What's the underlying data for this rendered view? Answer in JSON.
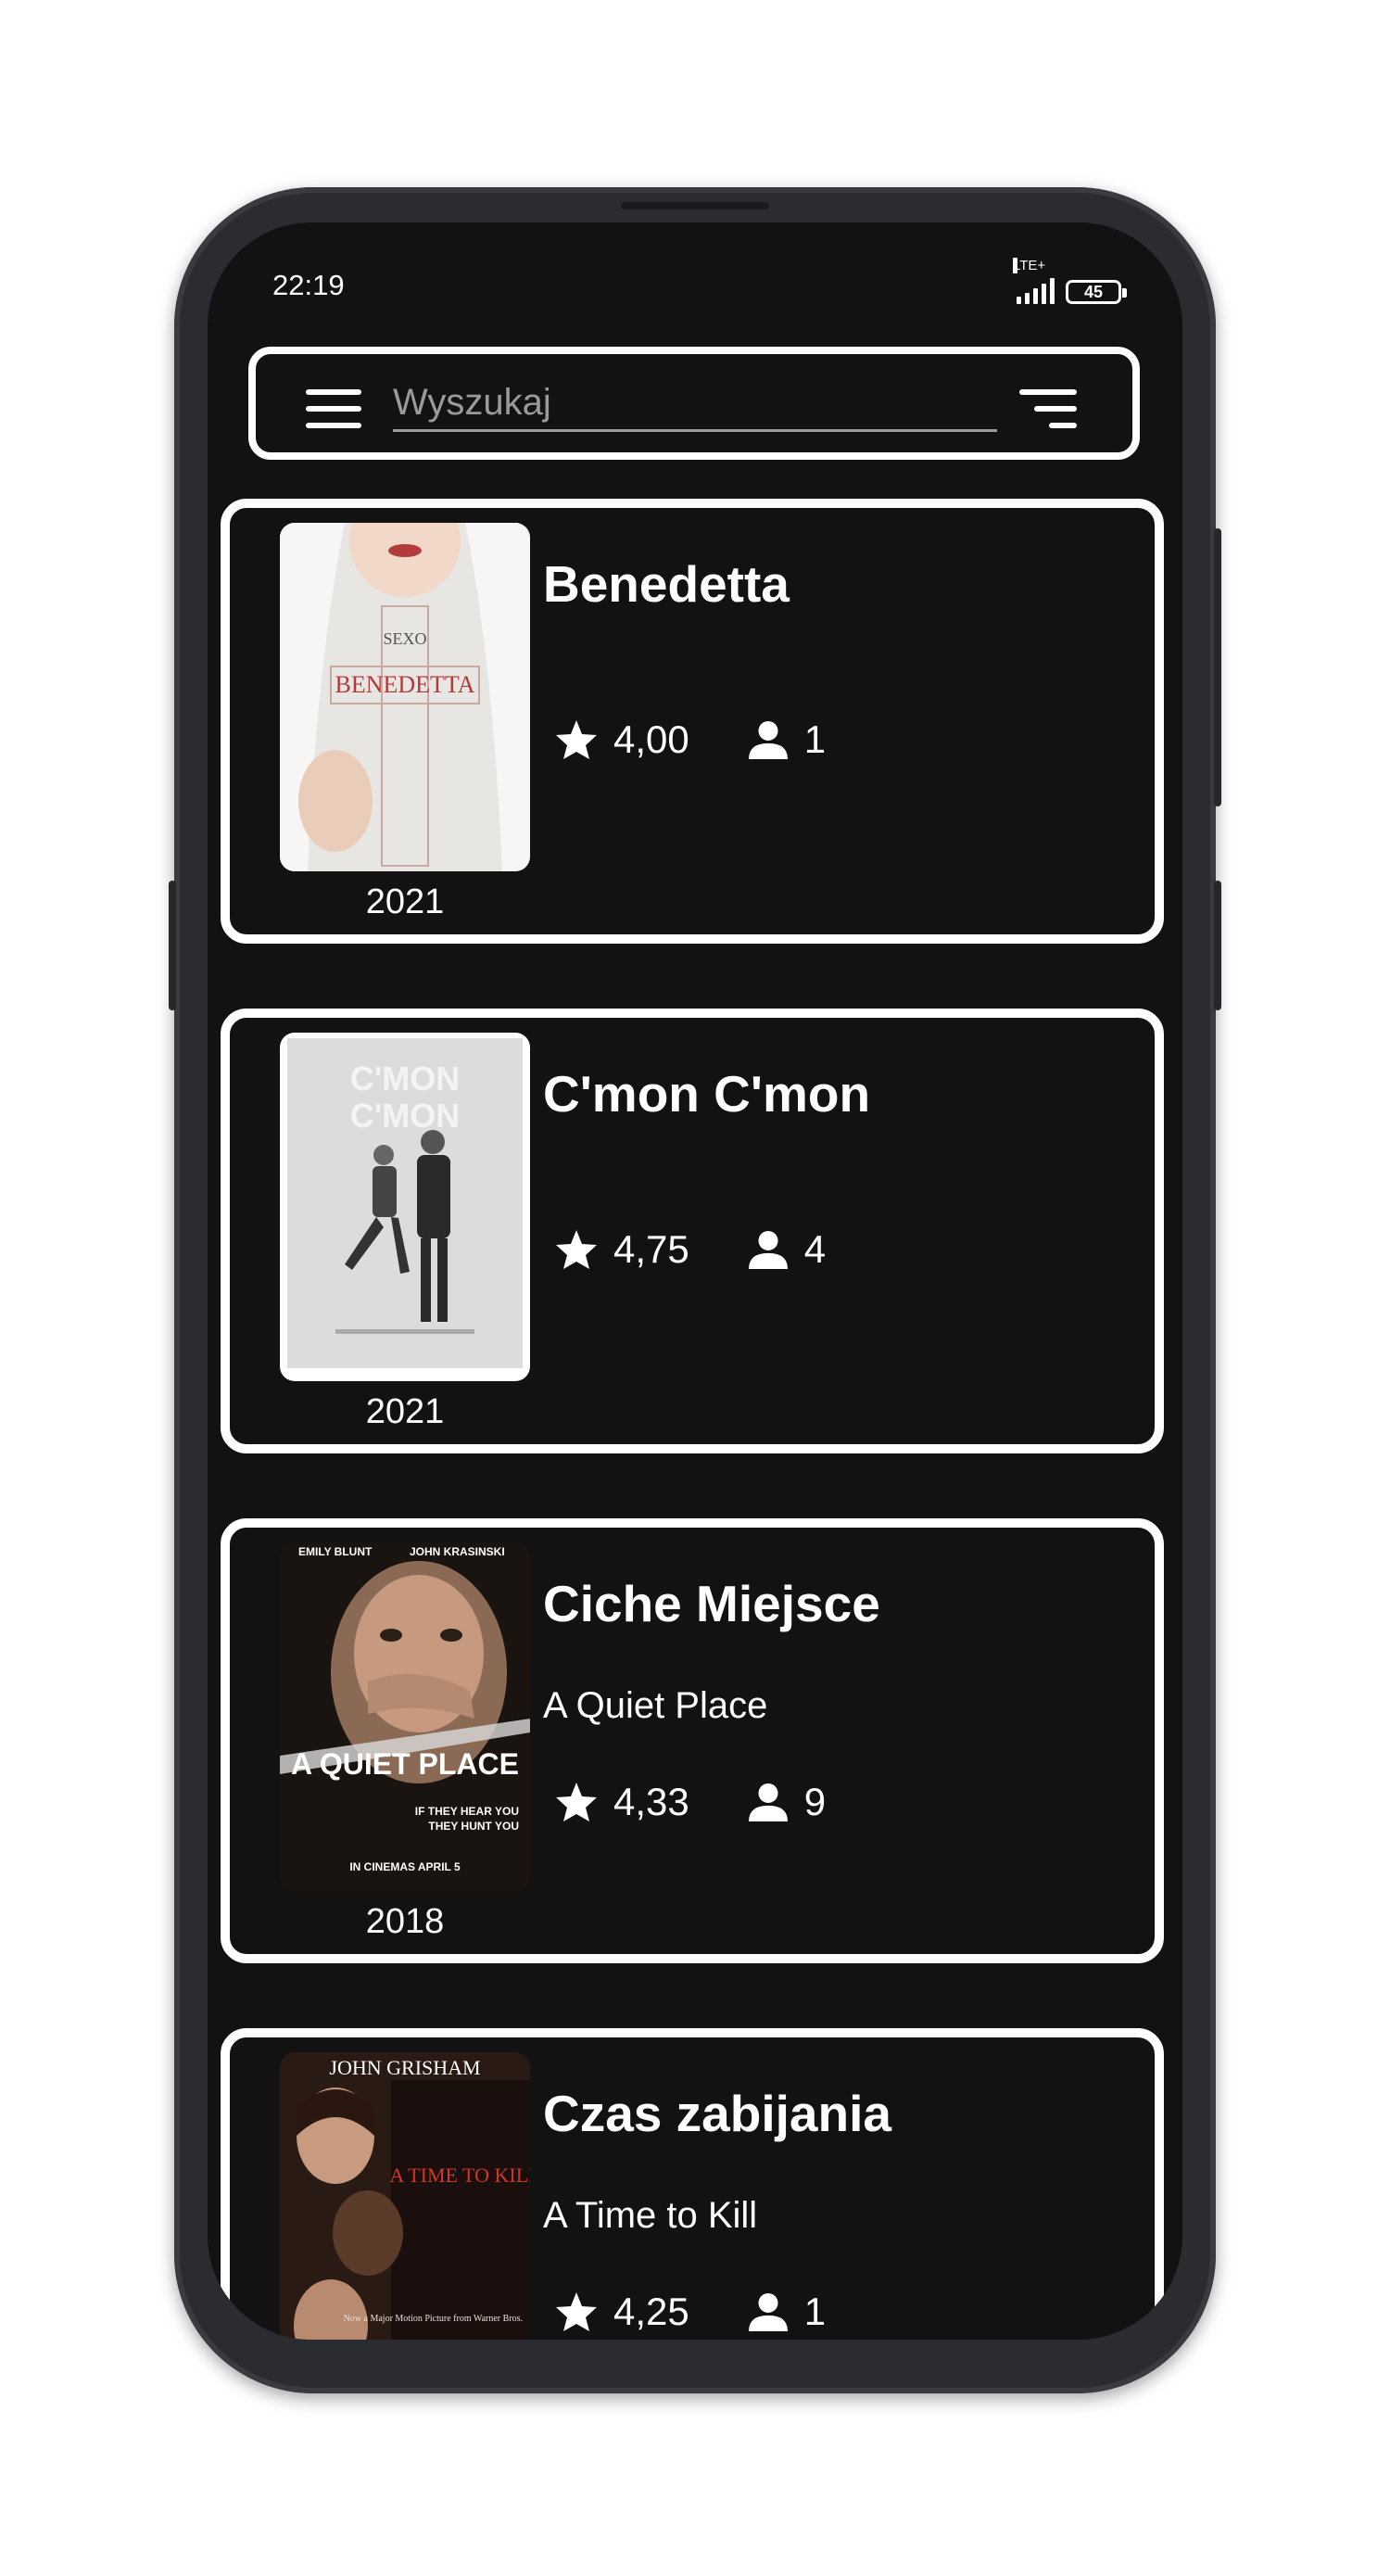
{
  "status_bar": {
    "time": "22:19",
    "network": "LTE+",
    "battery": "45"
  },
  "search": {
    "placeholder": "Wyszukaj",
    "value": ""
  },
  "icons": {
    "menu": "menu-icon",
    "sort": "sort-icon",
    "rating": "star-icon",
    "votes": "person-icon"
  },
  "colors": {
    "background": "#121212",
    "card_border": "#ffffff",
    "text": "#ffffff"
  },
  "movies": [
    {
      "title": "Benedetta",
      "original_title": "",
      "rating": "4,00",
      "votes": "1",
      "year": "2021",
      "poster_text": [
        "SEXO",
        "BENEDETTA"
      ]
    },
    {
      "title": "C'mon C'mon",
      "original_title": "",
      "rating": "4,75",
      "votes": "4",
      "year": "2021",
      "poster_text": [
        "C'MON",
        "C'MON"
      ]
    },
    {
      "title": "Ciche Miejsce",
      "original_title": "A Quiet Place",
      "rating": "4,33",
      "votes": "9",
      "year": "2018",
      "poster_text": [
        "EMILY BLUNT",
        "JOHN KRASINSKI",
        "A QUIET PLACE",
        "IF THEY HEAR YOU",
        "THEY HUNT YOU",
        "IN CINEMAS APRIL 5"
      ]
    },
    {
      "title": "Czas zabijania",
      "original_title": "A Time to Kill",
      "rating": "4,25",
      "votes": "1",
      "year": "",
      "poster_text": [
        "JOHN GRISHAM",
        "A TIME TO KILL",
        "Now a Major Motion Picture from Warner Bros."
      ]
    }
  ]
}
